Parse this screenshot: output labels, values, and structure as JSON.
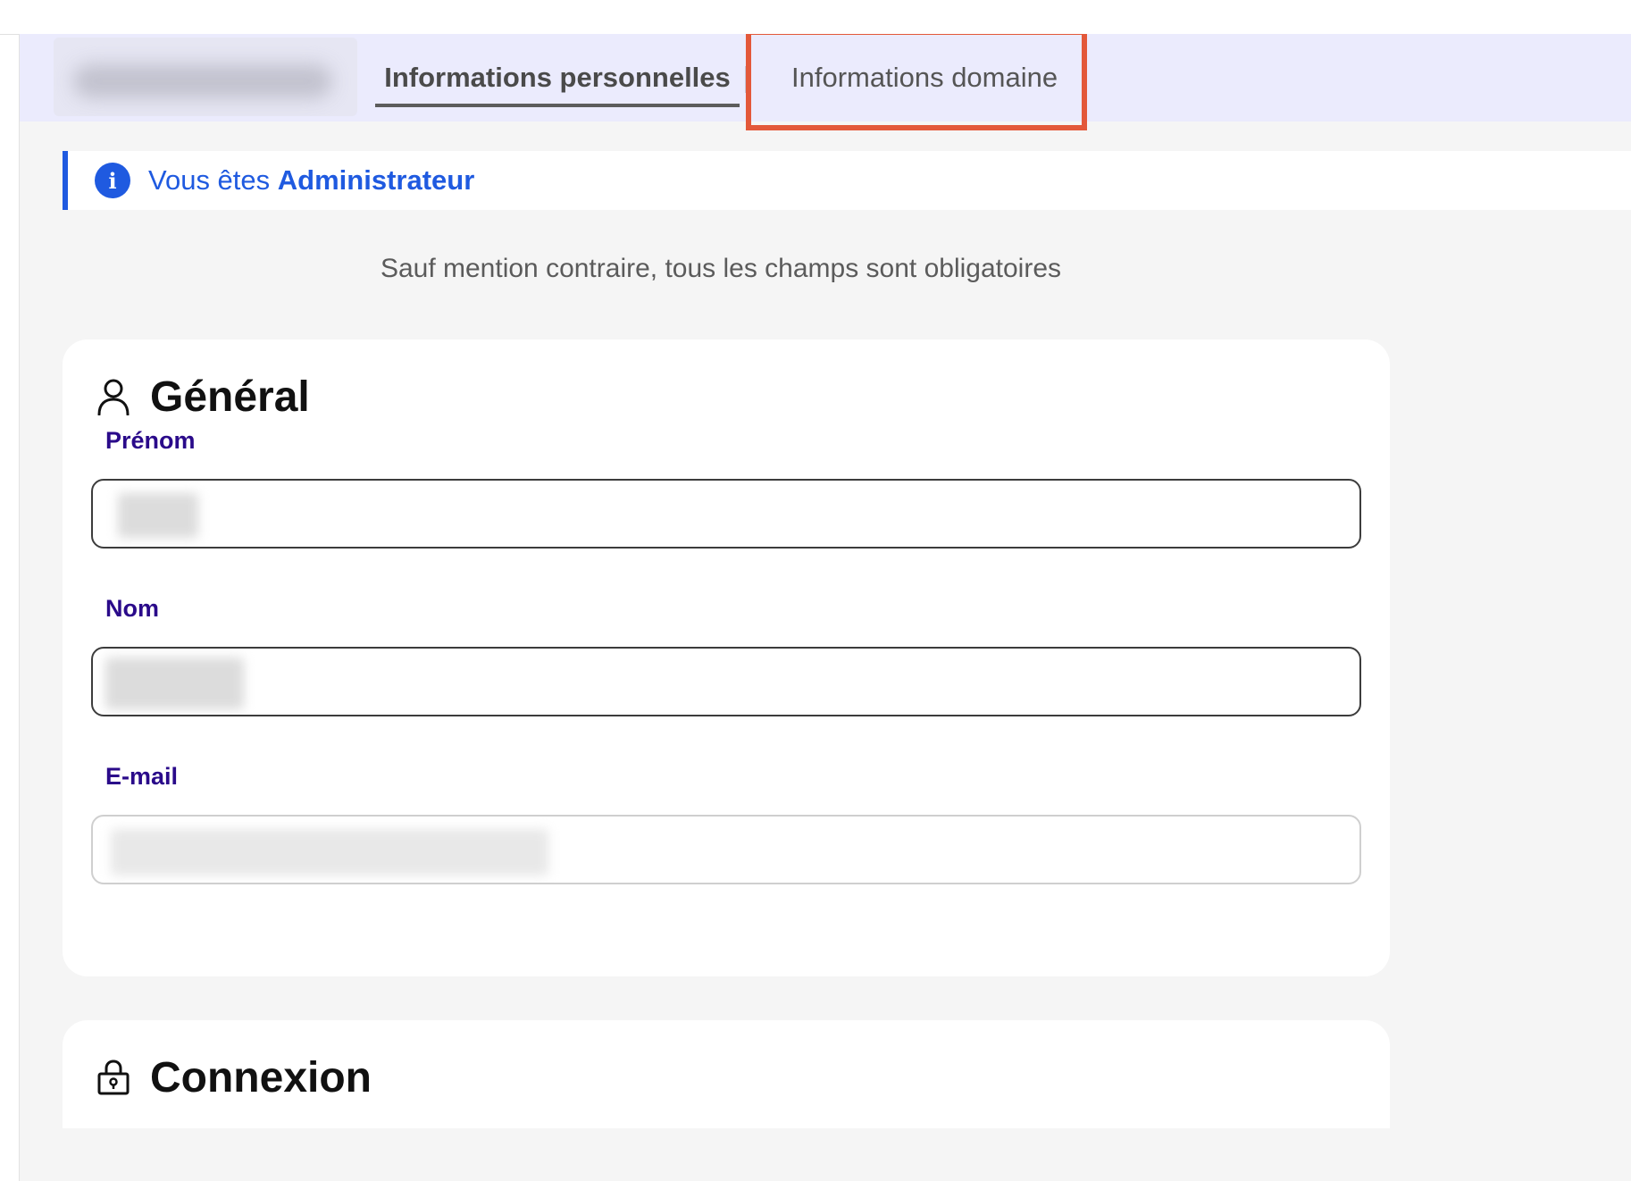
{
  "tabs": {
    "personal": "Informations personnelles",
    "domain": "Informations domaine",
    "active": "personal"
  },
  "notice": {
    "prefix": "Vous êtes",
    "role": "Administrateur"
  },
  "required_hint": "Sauf mention contraire, tous les champs sont obligatoires",
  "general": {
    "title": "Général",
    "icon": "user-icon",
    "fields": {
      "first_name": {
        "label": "Prénom",
        "value": ""
      },
      "last_name": {
        "label": "Nom",
        "value": ""
      },
      "email": {
        "label": "E-mail",
        "value": ""
      }
    }
  },
  "connexion": {
    "title": "Connexion",
    "icon": "lock-icon"
  },
  "colors": {
    "accent_blue": "#1f5ae0",
    "label_purple": "#2a0a8a",
    "tab_bar": "#ebebfd",
    "highlight": "#e3583a"
  }
}
